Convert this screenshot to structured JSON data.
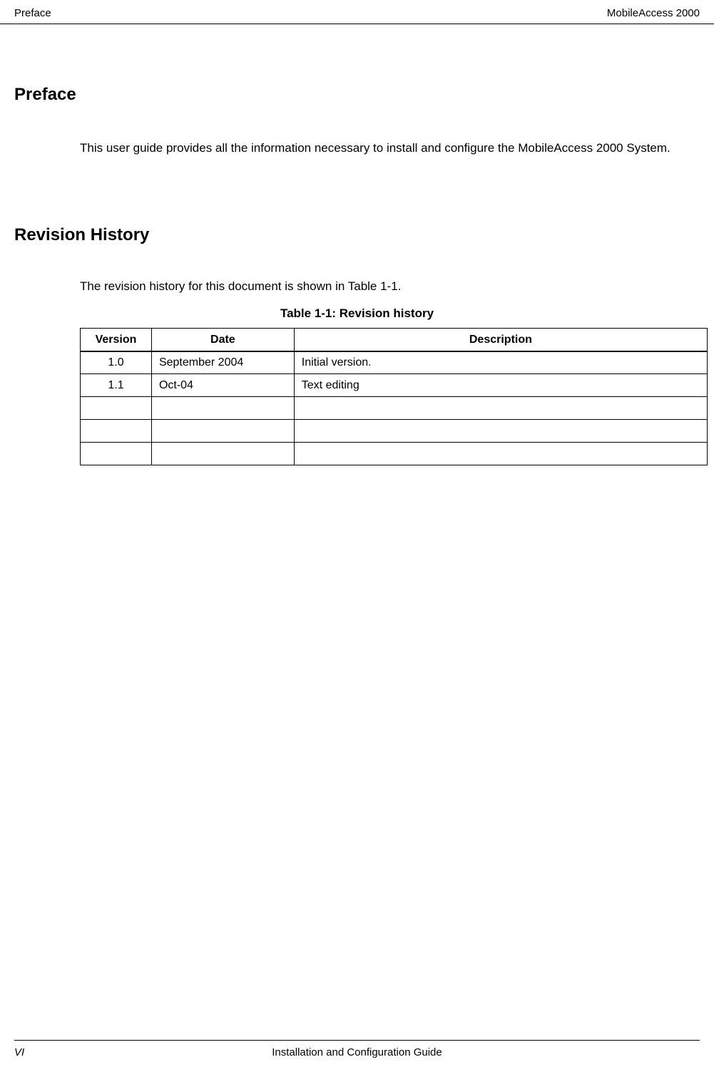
{
  "header": {
    "left": "Preface",
    "right": "MobileAccess 2000"
  },
  "preface": {
    "heading": "Preface",
    "body": "This user guide provides all the information necessary to install and configure the MobileAccess 2000 System."
  },
  "revision_history": {
    "heading": "Revision History",
    "intro": "The revision history for this document is shown in Table 1-1.",
    "table_caption": "Table 1-1:  Revision history",
    "columns": {
      "version": "Version",
      "date": "Date",
      "description": "Description"
    },
    "rows": [
      {
        "version": "1.0",
        "date": "September 2004",
        "description": "Initial version."
      },
      {
        "version": "1.1",
        "date": "Oct-04",
        "description": "Text editing"
      },
      {
        "version": "",
        "date": "",
        "description": ""
      },
      {
        "version": "",
        "date": "",
        "description": ""
      },
      {
        "version": "",
        "date": "",
        "description": ""
      }
    ]
  },
  "footer": {
    "left": "VI",
    "center": "Installation and Configuration Guide"
  }
}
